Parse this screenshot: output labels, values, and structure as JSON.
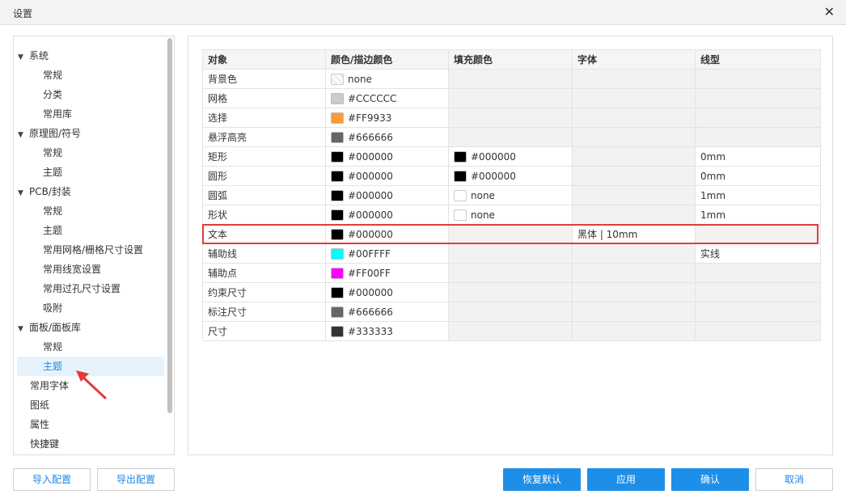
{
  "window": {
    "title": "设置",
    "close_glyph": "✕"
  },
  "sidebar": {
    "items": [
      {
        "label": "系统",
        "kind": "group"
      },
      {
        "label": "常规",
        "kind": "child"
      },
      {
        "label": "分类",
        "kind": "child"
      },
      {
        "label": "常用库",
        "kind": "child"
      },
      {
        "label": "原理图/符号",
        "kind": "group"
      },
      {
        "label": "常规",
        "kind": "child"
      },
      {
        "label": "主题",
        "kind": "child"
      },
      {
        "label": "PCB/封装",
        "kind": "group"
      },
      {
        "label": "常规",
        "kind": "child"
      },
      {
        "label": "主题",
        "kind": "child"
      },
      {
        "label": "常用网格/栅格尺寸设置",
        "kind": "child"
      },
      {
        "label": "常用线宽设置",
        "kind": "child"
      },
      {
        "label": "常用过孔尺寸设置",
        "kind": "child"
      },
      {
        "label": "吸附",
        "kind": "child"
      },
      {
        "label": "面板/面板库",
        "kind": "group"
      },
      {
        "label": "常规",
        "kind": "child"
      },
      {
        "label": "主题",
        "kind": "child",
        "selected": true
      },
      {
        "label": "常用字体",
        "kind": "top"
      },
      {
        "label": "图纸",
        "kind": "top"
      },
      {
        "label": "属性",
        "kind": "top"
      },
      {
        "label": "快捷键",
        "kind": "top"
      }
    ]
  },
  "table": {
    "headers": [
      "对象",
      "颜色/描边颜色",
      "填充颜色",
      "字体",
      "线型"
    ],
    "rows": [
      {
        "object": "背景色",
        "stroke": "none",
        "stroke_swatch": "checker",
        "fill": null,
        "fill_swatch": null,
        "font": null,
        "line": null
      },
      {
        "object": "网格",
        "stroke": "#CCCCCC",
        "stroke_swatch": "#CCCCCC",
        "fill": null,
        "fill_swatch": null,
        "font": null,
        "line": null
      },
      {
        "object": "选择",
        "stroke": "#FF9933",
        "stroke_swatch": "#FF9933",
        "fill": null,
        "fill_swatch": null,
        "font": null,
        "line": null
      },
      {
        "object": "悬浮高亮",
        "stroke": "#666666",
        "stroke_swatch": "#666666",
        "fill": null,
        "fill_swatch": null,
        "font": null,
        "line": null
      },
      {
        "object": "矩形",
        "stroke": "#000000",
        "stroke_swatch": "#000000",
        "fill": "#000000",
        "fill_swatch": "#000000",
        "font": null,
        "line": "0mm"
      },
      {
        "object": "圆形",
        "stroke": "#000000",
        "stroke_swatch": "#000000",
        "fill": "#000000",
        "fill_swatch": "#000000",
        "font": null,
        "line": "0mm"
      },
      {
        "object": "圆弧",
        "stroke": "#000000",
        "stroke_swatch": "#000000",
        "fill": "none",
        "fill_swatch": "none",
        "font": null,
        "line": "1mm"
      },
      {
        "object": "形状",
        "stroke": "#000000",
        "stroke_swatch": "#000000",
        "fill": "none",
        "fill_swatch": "none",
        "font": null,
        "line": "1mm"
      },
      {
        "object": "文本",
        "stroke": "#000000",
        "stroke_swatch": "#000000",
        "fill": null,
        "fill_swatch": null,
        "font": "黑体 | 10mm",
        "line": null,
        "highlighted": true
      },
      {
        "object": "辅助线",
        "stroke": "#00FFFF",
        "stroke_swatch": "#00FFFF",
        "fill": null,
        "fill_swatch": null,
        "font": null,
        "line": "实线"
      },
      {
        "object": "辅助点",
        "stroke": "#FF00FF",
        "stroke_swatch": "#FF00FF",
        "fill": null,
        "fill_swatch": null,
        "font": null,
        "line": null
      },
      {
        "object": "约束尺寸",
        "stroke": "#000000",
        "stroke_swatch": "#000000",
        "fill": null,
        "fill_swatch": null,
        "font": null,
        "line": null
      },
      {
        "object": "标注尺寸",
        "stroke": "#666666",
        "stroke_swatch": "#666666",
        "fill": null,
        "fill_swatch": null,
        "font": null,
        "line": null
      },
      {
        "object": "尺寸",
        "stroke": "#333333",
        "stroke_swatch": "#333333",
        "fill": null,
        "fill_swatch": null,
        "font": null,
        "line": null
      }
    ]
  },
  "footer": {
    "import_label": "导入配置",
    "export_label": "导出配置",
    "restore_label": "恢复默认",
    "apply_label": "应用",
    "confirm_label": "确认",
    "cancel_label": "取消"
  },
  "colors": {
    "accent": "#1E8FE8",
    "highlight_border": "#E03C3C",
    "annotation_arrow": "#E53935"
  }
}
